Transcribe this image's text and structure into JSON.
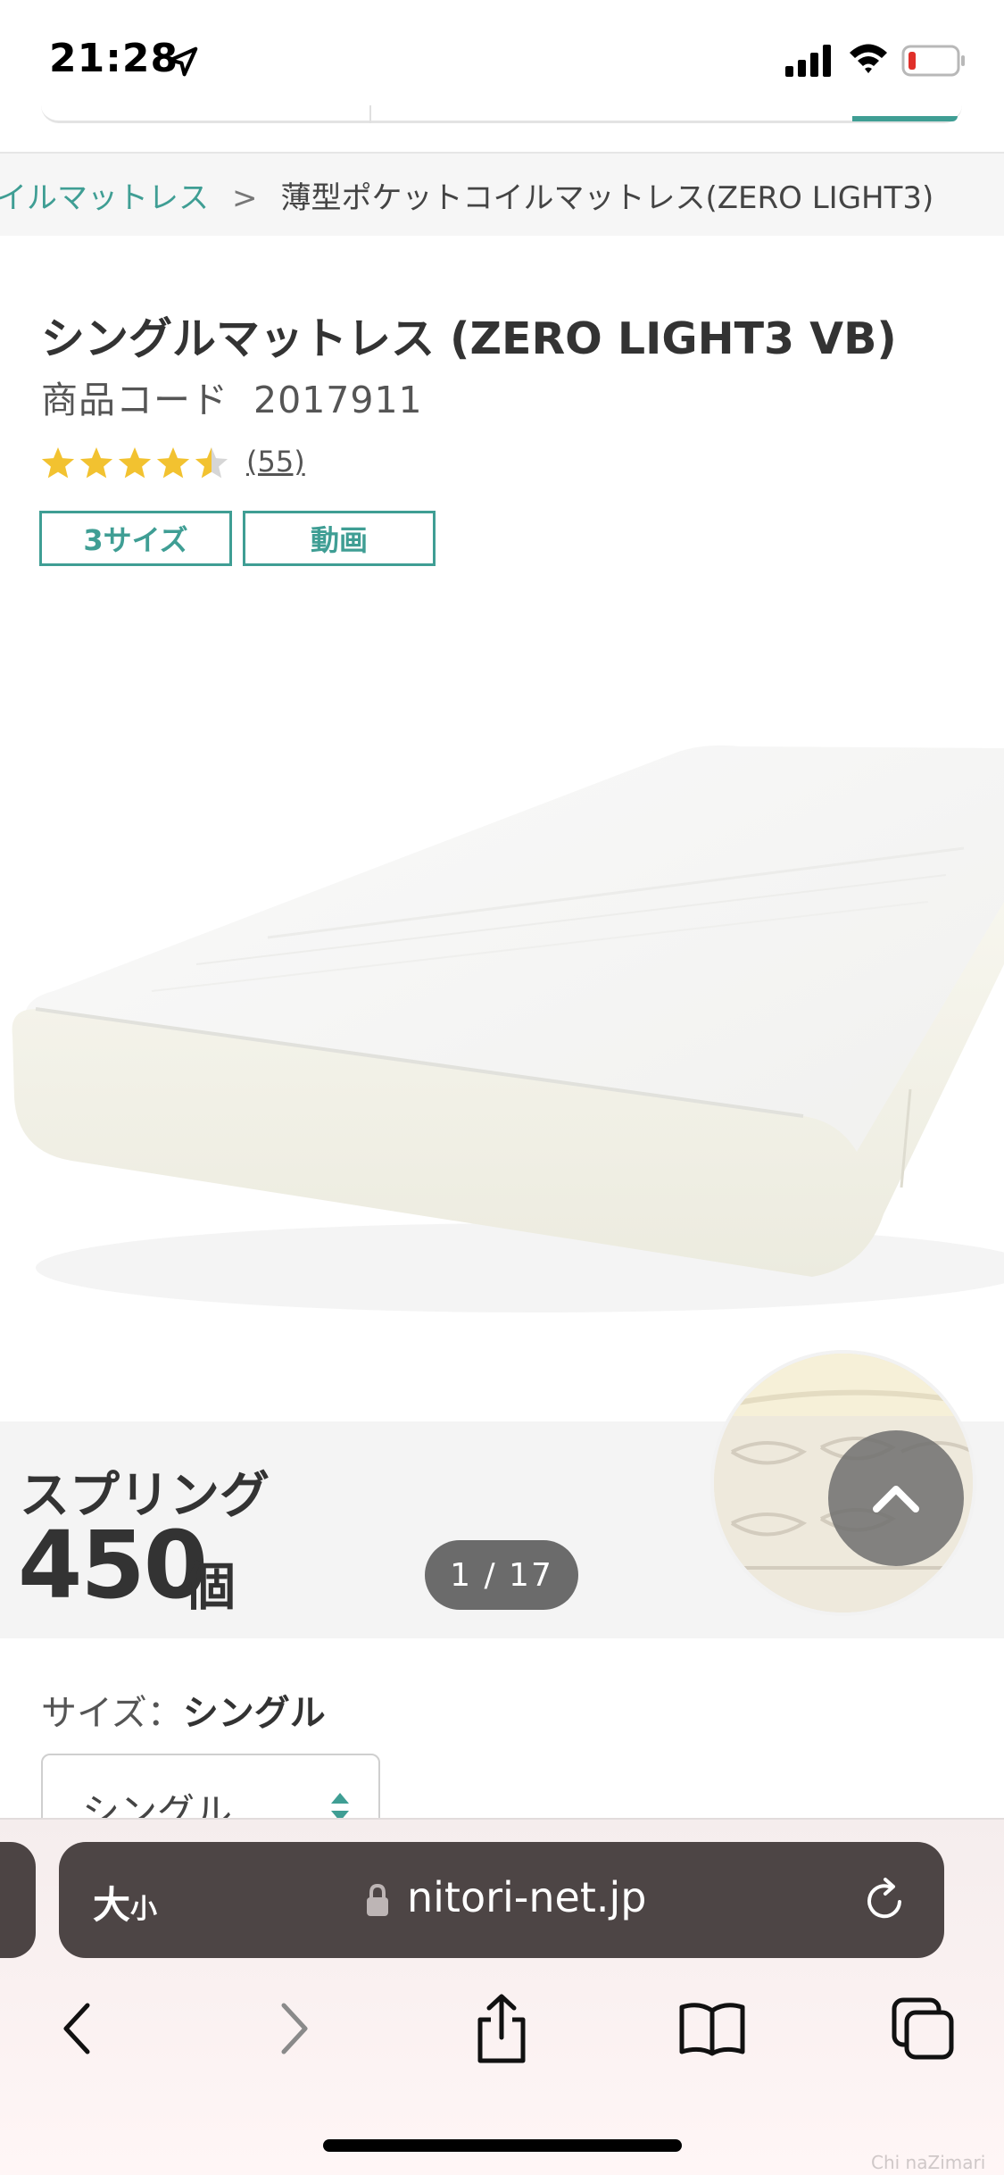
{
  "status_bar": {
    "time": "21:28"
  },
  "breadcrumb": {
    "items": [
      "イルマットレス",
      "薄型ポケットコイルマットレス(ZERO LIGHT3)"
    ],
    "separator": ">"
  },
  "product": {
    "title": "シングルマットレス (ZERO LIGHT3 VB)",
    "code_label": "商品コード",
    "code": "2017911",
    "rating": 4.5,
    "rating_max": 5,
    "review_count": "(55)",
    "tags": [
      "3サイズ",
      "動画"
    ]
  },
  "gallery": {
    "spring_label": "スプリング",
    "spring_count": "450",
    "spring_unit": "個",
    "page_indicator": "1 / 17"
  },
  "size": {
    "label": "サイズ：",
    "selected": "シングル",
    "select_value": "シングル"
  },
  "browser": {
    "text_size_label": "大",
    "text_size_small": "小",
    "url": "nitori-net.jp"
  },
  "colors": {
    "accent": "#3f9e94",
    "star": "#f2c230",
    "url_bar": "#4d4545"
  },
  "watermark": "Chi naZimari"
}
